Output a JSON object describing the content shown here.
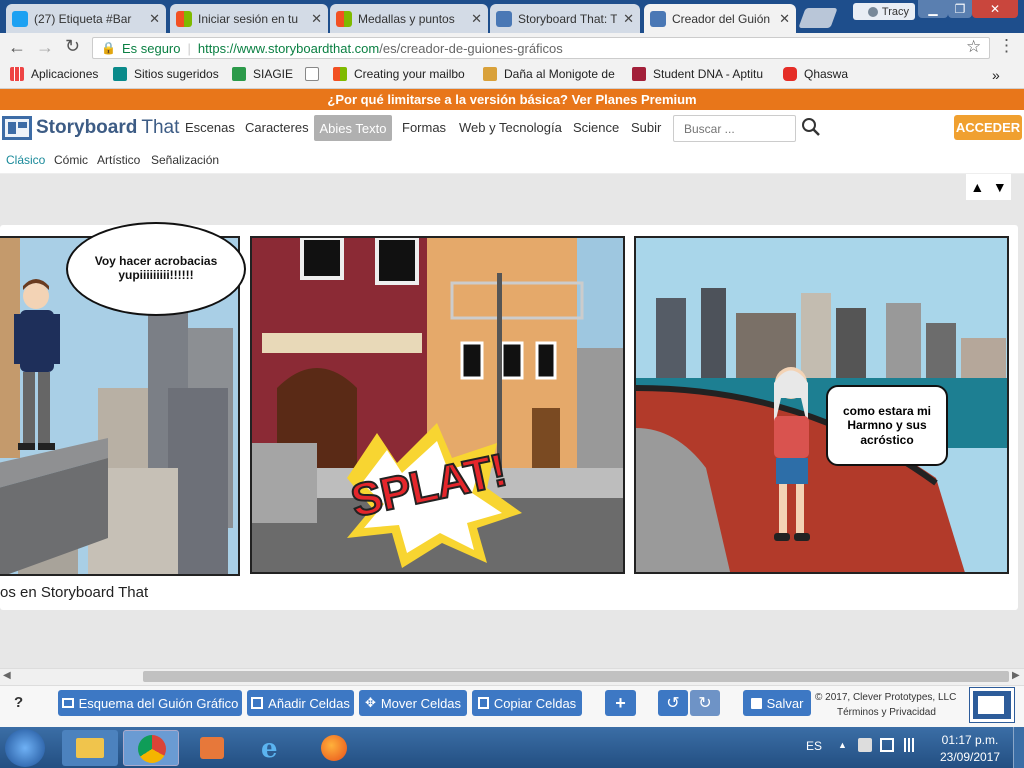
{
  "browser": {
    "tabs": [
      {
        "label": "(27) Etiqueta #Bar",
        "icon": "twitter-icon",
        "color": "#1da1f2"
      },
      {
        "label": "Iniciar sesión en tu",
        "icon": "microsoft-icon",
        "color": "#e94e1b"
      },
      {
        "label": "Medallas y puntos",
        "icon": "microsoft-icon",
        "color": "#e94e1b"
      },
      {
        "label": "Storyboard That: T",
        "icon": "storyboard-icon",
        "color": "#4a78b5"
      },
      {
        "label": "Creador del Guión",
        "icon": "storyboard-icon",
        "color": "#4a78b5"
      }
    ],
    "profile_name": "Tracy",
    "secure_label": "Es seguro",
    "url_prefix": "https://www.storyboardthat.com",
    "url_path": "/es/creador-de-guiones-gráficos",
    "bookmarks": [
      {
        "label": "Aplicaciones"
      },
      {
        "label": "Sitios sugeridos"
      },
      {
        "label": "SIAGIE"
      },
      {
        "label": ""
      },
      {
        "label": "Creating your mailbo"
      },
      {
        "label": "Daña al Monigote de"
      },
      {
        "label": "Student DNA - Aptitu"
      },
      {
        "label": "Qhaswa"
      }
    ],
    "more_bookmarks": "»"
  },
  "site": {
    "promo": "¿Por qué limitarse a la versión básica? Ver Planes Premium",
    "logo_text_1": "Storyboard",
    "logo_text_2": "That",
    "nav": [
      "Escenas",
      "Caracteres",
      "Abies Texto",
      "Formas",
      "Web y Tecnología",
      "Science",
      "Subir"
    ],
    "active_nav": "Abies Texto",
    "search_placeholder": "Buscar ...",
    "login": "ACCEDER",
    "subnav": [
      "Clásico",
      "Cómic",
      "Artístico",
      "Señalización"
    ],
    "active_sub": "Clásico",
    "up_arrow": "▲",
    "down_arrow": "▼"
  },
  "storyboard": {
    "panel1_bubble": "Voy hacer acrobacias yupiiiiiiiii!!!!!!",
    "panel2_splat": "SPLAT!",
    "panel3_bubble": "como estara mi Harmno y sus acróstico",
    "caption": "os en Storyboard That"
  },
  "toolbar": {
    "help": "?",
    "buttons": [
      "Esquema del Guión Gráfico",
      "Añadir Celdas",
      "Mover Celdas",
      "Copiar Celdas"
    ],
    "save": "Salvar",
    "copyright": "© 2017, Clever Prototypes, LLC",
    "terms": "Términos y Privacidad"
  },
  "taskbar": {
    "lang": "ES",
    "time": "01:17 p.m.",
    "date": "23/09/2017"
  },
  "colors": {
    "accent": "#3d78c4",
    "promo": "#e8761a",
    "login": "#f0a030"
  }
}
